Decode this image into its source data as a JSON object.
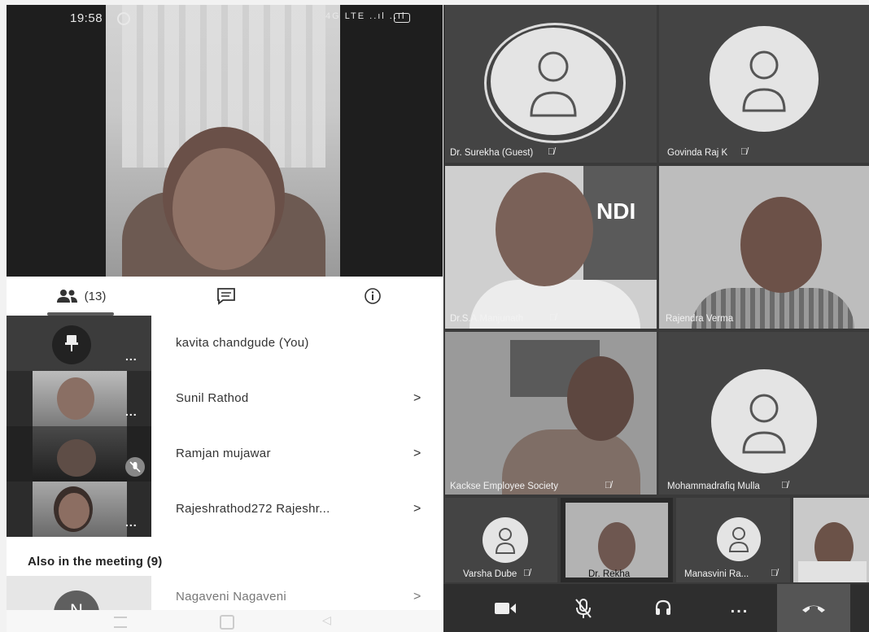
{
  "left": {
    "status": {
      "time": "19:58",
      "network": "4G LTE ..ıl ..ıl"
    },
    "tabs": {
      "people_count": "(13)"
    },
    "participants": [
      {
        "name": "kavita chandgude (You)"
      },
      {
        "name": "Sunil Rathod"
      },
      {
        "name": "Ramjan mujawar"
      },
      {
        "name": "Rajeshrathod272 Rajeshr..."
      },
      {
        "name": "Nagaveni Nagaveni"
      }
    ],
    "section_title": "Also in the meeting (9)",
    "avatar_initial": "N",
    "chevron": ">",
    "more": "..."
  },
  "right": {
    "tiles": [
      {
        "name": "Dr. Surekha (Guest)"
      },
      {
        "name": "Govinda Raj K"
      },
      {
        "name": "Dr.S.A.Manjunath"
      },
      {
        "name": "Rajendra Verma"
      },
      {
        "name": "Kackse Employee Society"
      },
      {
        "name": "Mohammadrafiq Mulla"
      },
      {
        "name": "Varsha Dube"
      },
      {
        "name": "Dr. Rekha"
      },
      {
        "name": "Manasvini Ra..."
      }
    ],
    "banner_text": "NDI",
    "colors": {
      "tile_bg": "#444444",
      "toolbar_bg": "#2e2e2e",
      "hangup": "#555555"
    }
  }
}
